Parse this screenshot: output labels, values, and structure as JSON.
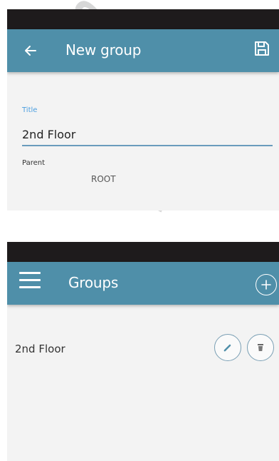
{
  "edit_screen": {
    "title": "New group",
    "form": {
      "title_label": "Title",
      "title_value": "2nd Floor",
      "parent_label": "Parent",
      "parent_value": "ROOT"
    },
    "icons": {
      "back": "arrow-left-icon",
      "save": "floppy-disk-icon"
    }
  },
  "list_screen": {
    "title": "Groups",
    "items": [
      {
        "name": "2nd Floor"
      }
    ],
    "icons": {
      "menu": "hamburger-menu-icon",
      "add": "plus-circle-icon",
      "edit": "pencil-icon",
      "delete": "trash-icon"
    }
  },
  "colors": {
    "app_bar": "#4f8fa9",
    "status_bar": "#1e1b1c",
    "background": "#f3f3f3",
    "label_accent": "#4b9ee0"
  }
}
